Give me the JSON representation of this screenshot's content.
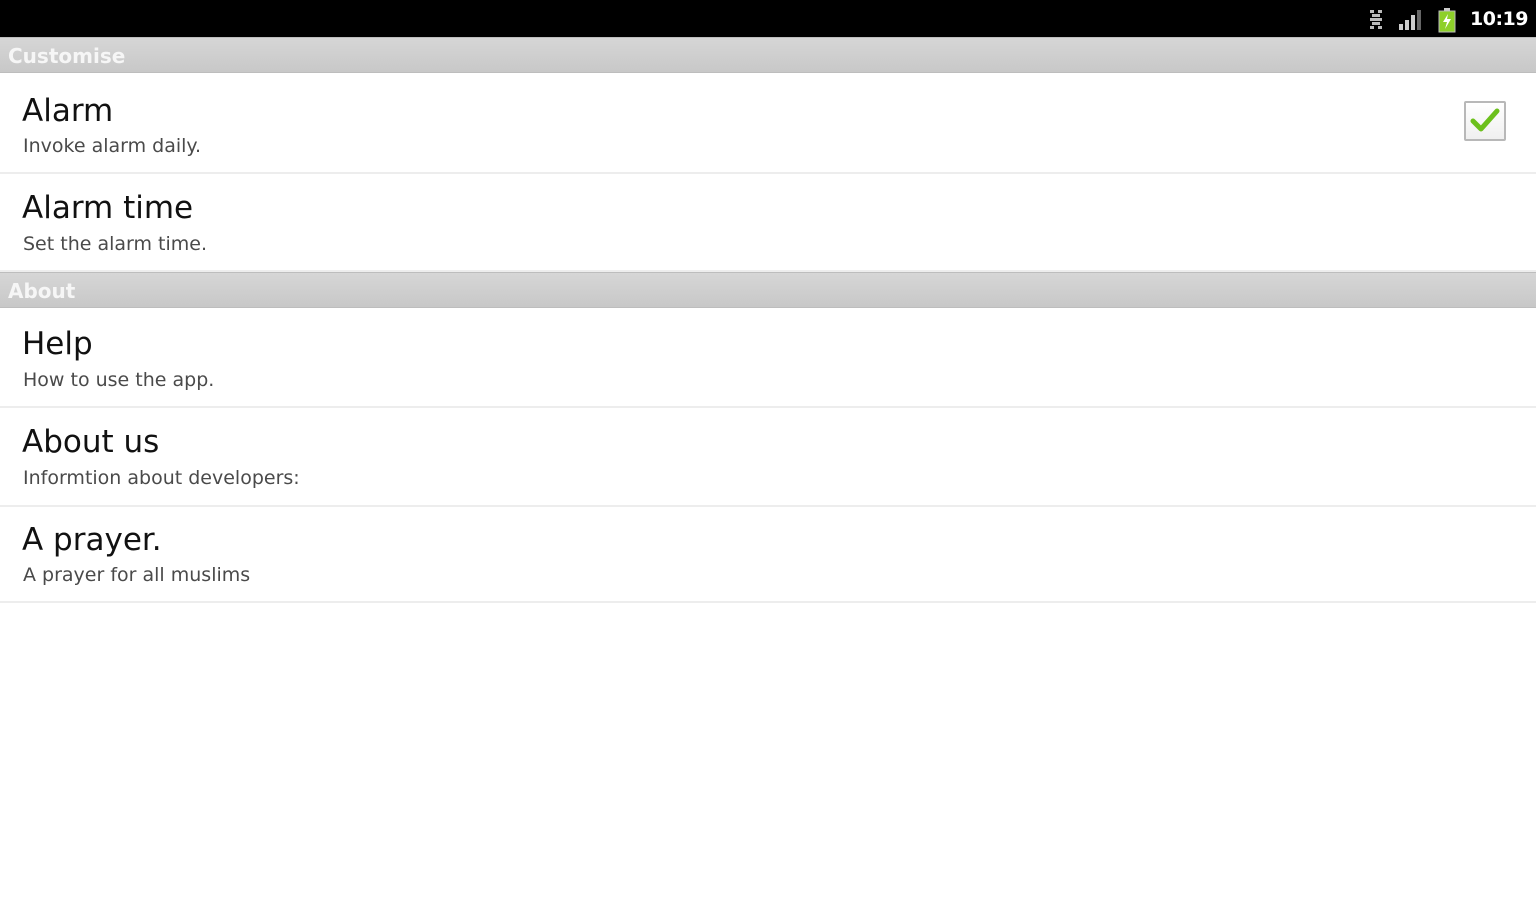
{
  "status_bar": {
    "time": "10:19",
    "icons": [
      "usb-debugging-icon",
      "signal-icon",
      "battery-charging-icon"
    ]
  },
  "sections": [
    {
      "header": "Customise",
      "items": [
        {
          "title": "Alarm",
          "summary": "Invoke alarm daily.",
          "checked": true
        },
        {
          "title": "Alarm time",
          "summary": "Set the alarm time."
        }
      ]
    },
    {
      "header": "About",
      "items": [
        {
          "title": "Help",
          "summary": "How to use the app."
        },
        {
          "title": "About us",
          "summary": "Informtion about developers:"
        },
        {
          "title": "A prayer.",
          "summary": "A prayer for all muslims"
        }
      ]
    }
  ],
  "colors": {
    "checkmark": "#6cc01c",
    "battery": "#8ed02a"
  }
}
